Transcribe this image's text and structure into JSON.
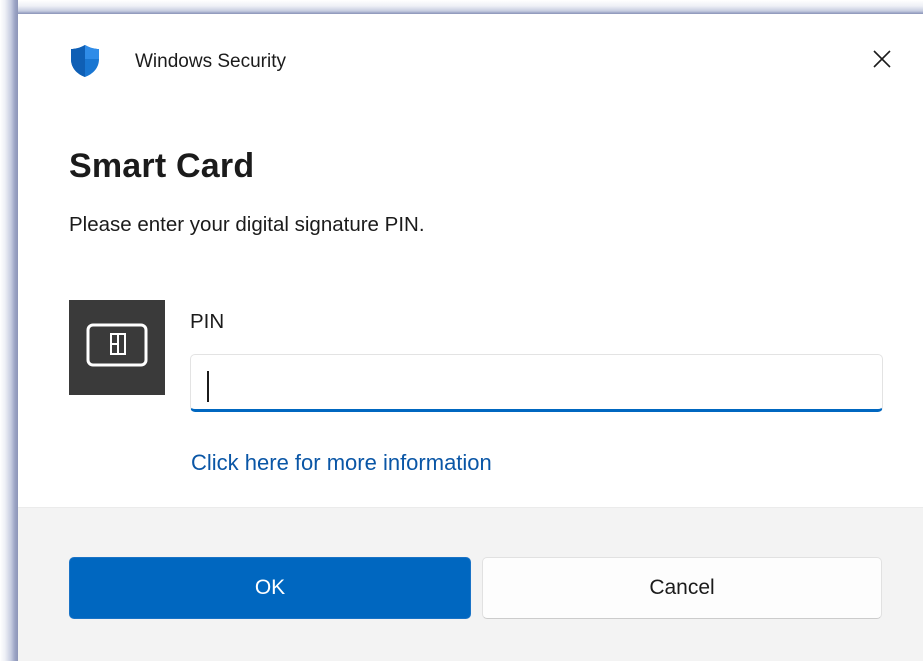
{
  "window": {
    "title": "Windows Security",
    "close_icon": "close-icon",
    "app_icon": "shield-icon"
  },
  "dialog": {
    "heading": "Smart Card",
    "description": "Please enter your digital signature PIN.",
    "card_icon": "smart-card-icon"
  },
  "pin_field": {
    "label": "PIN",
    "value": "",
    "placeholder": ""
  },
  "link": {
    "more_info": "Click here for more information"
  },
  "buttons": {
    "ok": "OK",
    "cancel": "Cancel"
  },
  "colors": {
    "accent": "#0067c0",
    "link": "#0a56a6",
    "card_tile": "#3a3a3a",
    "footer": "#f3f3f3"
  }
}
